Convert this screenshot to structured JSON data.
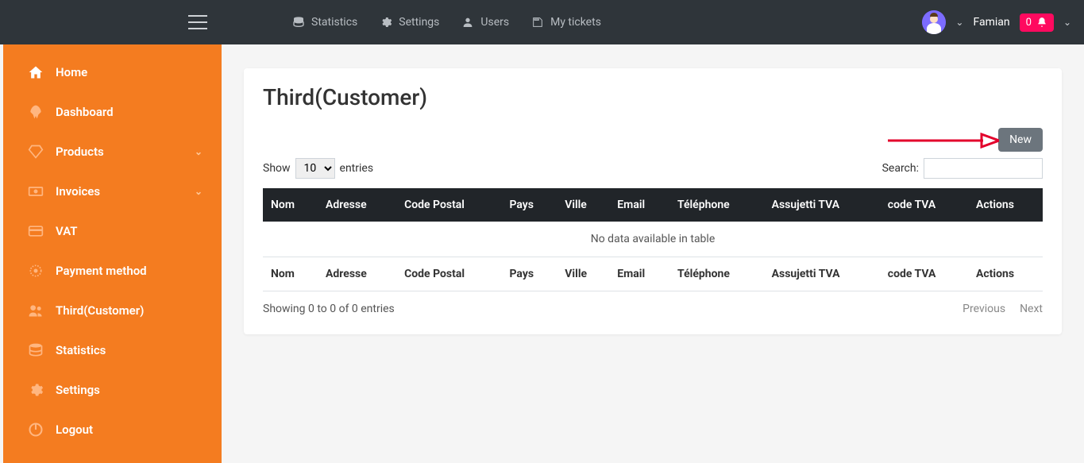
{
  "topnav": [
    {
      "label": "Statistics",
      "icon": "database"
    },
    {
      "label": "Settings",
      "icon": "gear"
    },
    {
      "label": "Users",
      "icon": "user"
    },
    {
      "label": "My tickets",
      "icon": "ticket"
    }
  ],
  "user": {
    "name": "Famian",
    "notif_count": "0"
  },
  "sidebar": [
    {
      "label": "Home",
      "icon": "home"
    },
    {
      "label": "Dashboard",
      "icon": "rocket"
    },
    {
      "label": "Products",
      "icon": "diamond",
      "expandable": true
    },
    {
      "label": "Invoices",
      "icon": "money",
      "expandable": true
    },
    {
      "label": "VAT",
      "icon": "card"
    },
    {
      "label": "Payment method",
      "icon": "gear-dotted"
    },
    {
      "label": "Third(Customer)",
      "icon": "users"
    },
    {
      "label": "Statistics",
      "icon": "database"
    },
    {
      "label": "Settings",
      "icon": "gear"
    },
    {
      "label": "Logout",
      "icon": "power"
    }
  ],
  "page": {
    "title": "Third(Customer)",
    "new_button": "New",
    "show_label": "Show",
    "entries_label": "entries",
    "length_value": "10",
    "search_label": "Search:",
    "search_value": "",
    "columns": [
      "Nom",
      "Adresse",
      "Code Postal",
      "Pays",
      "Ville",
      "Email",
      "Téléphone",
      "Assujetti TVA",
      "code TVA",
      "Actions"
    ],
    "empty_text": "No data available in table",
    "info_text": "Showing 0 to 0 of 0 entries",
    "prev_label": "Previous",
    "next_label": "Next"
  }
}
